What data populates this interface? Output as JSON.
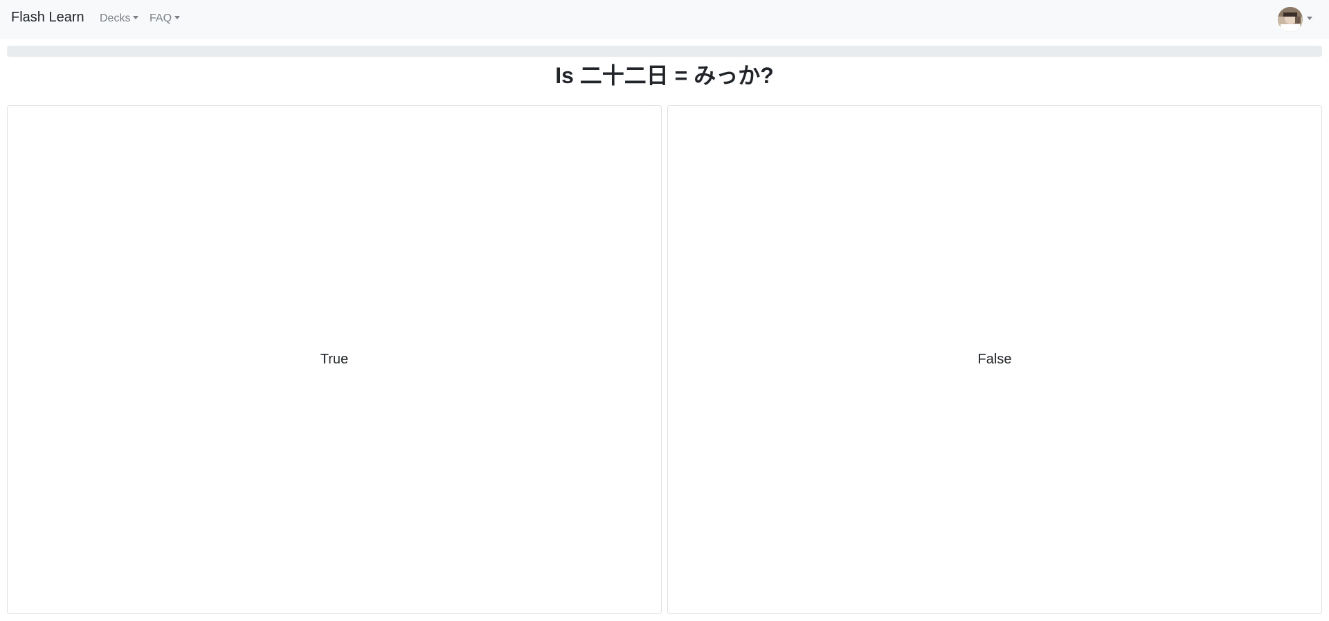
{
  "navbar": {
    "brand": "Flash Learn",
    "menu": [
      {
        "label": "Decks"
      },
      {
        "label": "FAQ"
      }
    ]
  },
  "user": {
    "avatar_icon": "user-avatar-icon"
  },
  "quiz": {
    "progress_fraction": 0,
    "question": "Is 二十二日 = みっか?",
    "answers": [
      {
        "label": "True"
      },
      {
        "label": "False"
      }
    ]
  },
  "colors": {
    "navbar_bg": "#f8f9fa",
    "progress_track": "#e9ecef",
    "card_border": "#dee2e6",
    "nav_text": "#7a7f85"
  }
}
